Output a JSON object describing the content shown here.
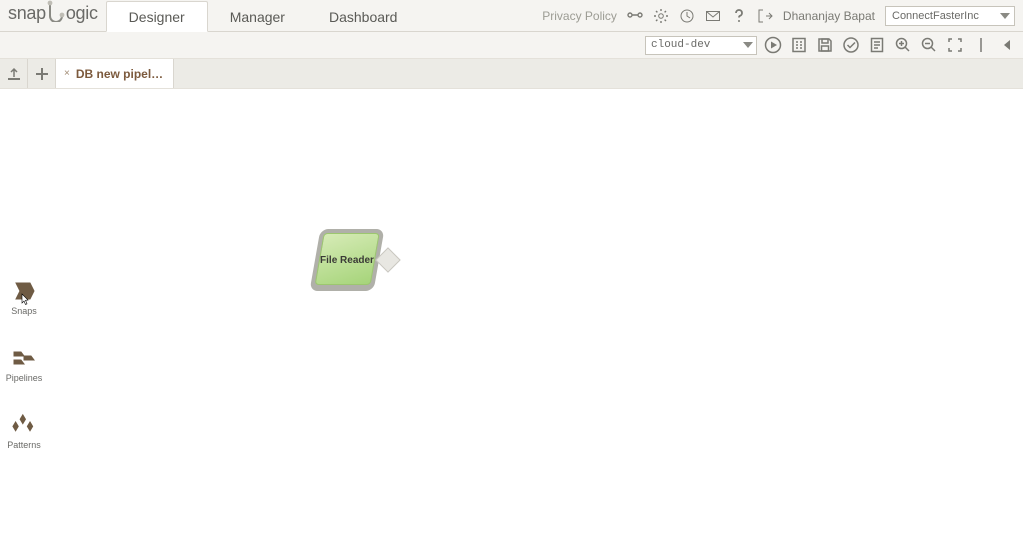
{
  "brand": {
    "part1": "snap",
    "part2": "ogic"
  },
  "nav": {
    "designer": "Designer",
    "manager": "Manager",
    "dashboard": "Dashboard"
  },
  "header": {
    "privacy": "Privacy Policy",
    "username": "Dhananjay Bapat",
    "org": "ConnectFasterInc"
  },
  "toolbar": {
    "environment": "cloud-dev"
  },
  "pipeline_tab": {
    "label": "DB new pipel…",
    "close": "×"
  },
  "canvas": {
    "snap_label": "File Reader"
  },
  "palette": {
    "snaps": "Snaps",
    "pipelines": "Pipelines",
    "patterns": "Patterns"
  }
}
